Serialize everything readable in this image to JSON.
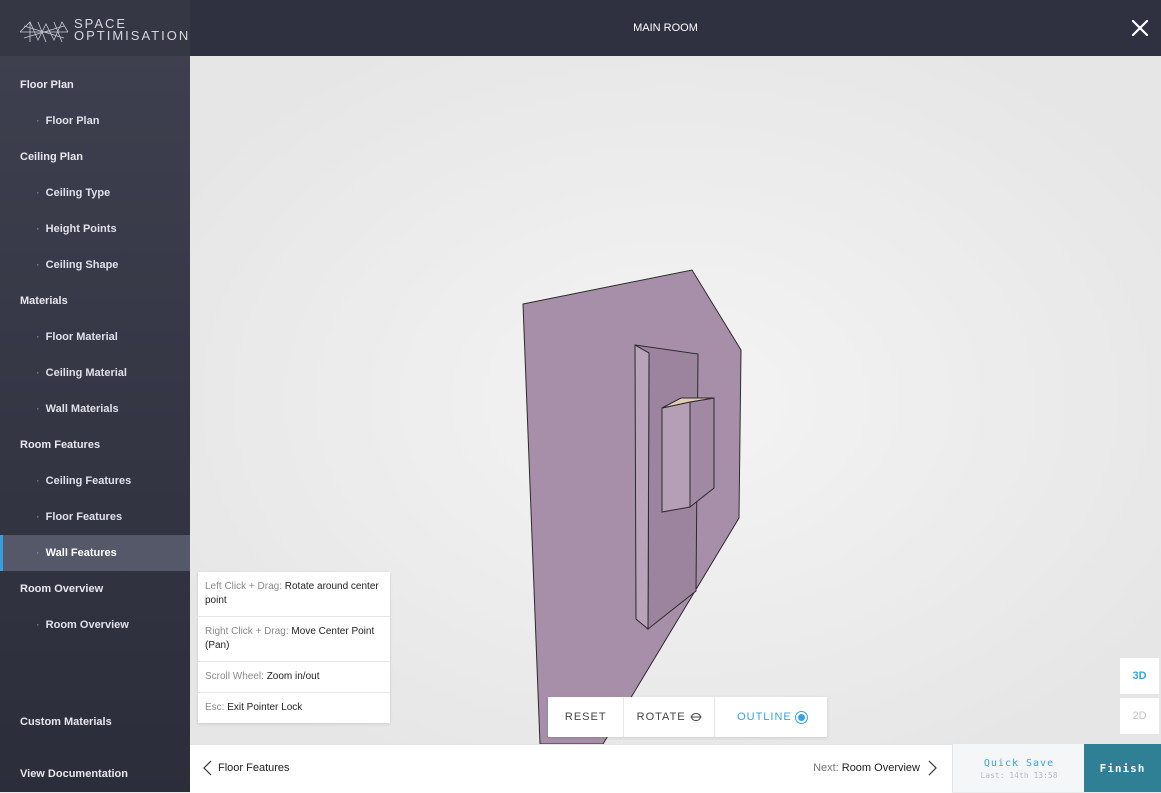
{
  "brand": {
    "line1": "SPACE",
    "line2": "OPTIMISATION"
  },
  "header": {
    "title": "MAIN ROOM"
  },
  "sidebar": {
    "items": [
      {
        "label": "Floor Plan",
        "kind": "section"
      },
      {
        "label": "Floor Plan",
        "kind": "sub"
      },
      {
        "label": "Ceiling Plan",
        "kind": "section"
      },
      {
        "label": "Ceiling Type",
        "kind": "sub"
      },
      {
        "label": "Height Points",
        "kind": "sub"
      },
      {
        "label": "Ceiling Shape",
        "kind": "sub"
      },
      {
        "label": "Materials",
        "kind": "section"
      },
      {
        "label": "Floor Material",
        "kind": "sub"
      },
      {
        "label": "Ceiling Material",
        "kind": "sub"
      },
      {
        "label": "Wall Materials",
        "kind": "sub"
      },
      {
        "label": "Room Features",
        "kind": "section"
      },
      {
        "label": "Ceiling Features",
        "kind": "sub"
      },
      {
        "label": "Floor Features",
        "kind": "sub"
      },
      {
        "label": "Wall Features",
        "kind": "sub",
        "active": true
      },
      {
        "label": "Room Overview",
        "kind": "section"
      },
      {
        "label": "Room Overview",
        "kind": "sub"
      }
    ],
    "custom_materials": "Custom Materials",
    "view_documentation": "View Documentation",
    "bullet": "·"
  },
  "help": [
    {
      "key": "Left Click + Drag:",
      "value": "Rotate around center point"
    },
    {
      "key": "Right Click + Drag:",
      "value": "Move Center Point (Pan)"
    },
    {
      "key": "Scroll Wheel:",
      "value": "Zoom in/out"
    },
    {
      "key": "Esc:",
      "value": "Exit Pointer Lock"
    }
  ],
  "toolbar": {
    "reset": "RESET",
    "rotate": "ROTATE",
    "outline": "OUTLINE"
  },
  "view_switch": {
    "three_d": "3D",
    "two_d": "2D",
    "selected": "3D"
  },
  "footer": {
    "prev_label": "Floor Features",
    "next_prefix": "Next:",
    "next_label": "Room Overview",
    "quick_save": "Quick Save",
    "last_saved": "Last: 14th 13:58",
    "finish": "Finish"
  },
  "colors": {
    "accent": "#3aa3e3",
    "finish": "#2f7f95",
    "wall": "#a78fa9",
    "sidebar": "#363846"
  },
  "icons": {
    "close": "close-icon",
    "rotate": "rotate-icon",
    "prev": "chevron-left-icon",
    "next": "chevron-right-icon"
  }
}
